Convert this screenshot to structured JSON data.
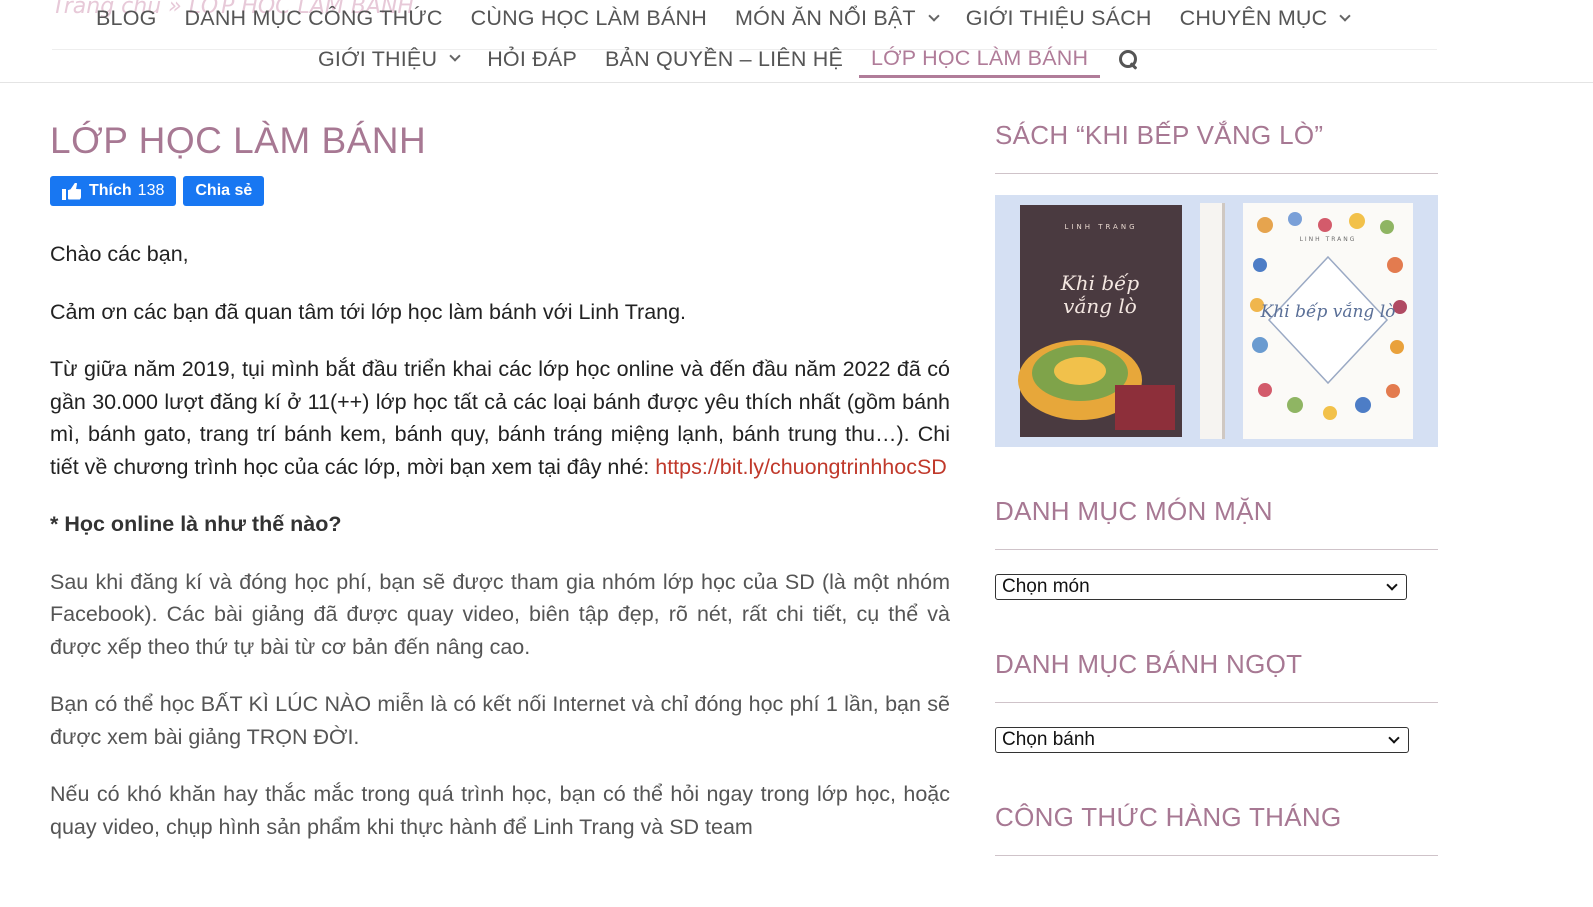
{
  "breadcrumb": {
    "home": "Trang chủ",
    "sep": "»",
    "current": "LỚP HỌC LÀM BÁNH"
  },
  "nav": {
    "row1": [
      {
        "label": "BLOG",
        "dropdown": false
      },
      {
        "label": "DANH MỤC CÔNG THỨC",
        "dropdown": false
      },
      {
        "label": "CÙNG HỌC LÀM BÁNH",
        "dropdown": false
      },
      {
        "label": "MÓN ĂN NỔI BẬT",
        "dropdown": true
      },
      {
        "label": "GIỚI THIỆU SÁCH",
        "dropdown": false
      },
      {
        "label": "CHUYÊN MỤC",
        "dropdown": true
      }
    ],
    "row2": [
      {
        "label": "GIỚI THIỆU",
        "dropdown": true
      },
      {
        "label": "HỎI ĐÁP",
        "dropdown": false
      },
      {
        "label": "BẢN QUYỀN – LIÊN HỆ",
        "dropdown": false
      },
      {
        "label": "LỚP HỌC LÀM BÁNH",
        "dropdown": false,
        "active": true
      }
    ],
    "search_icon": "search-icon"
  },
  "main": {
    "title": "LỚP HỌC LÀM BÁNH",
    "like_label": "Thích",
    "like_count": "138",
    "share_label": "Chia sẻ",
    "p1": "Chào các bạn,",
    "p2": "Cảm ơn các bạn đã quan tâm tới lớp học làm bánh với Linh Trang.",
    "p3": "Từ giữa năm 2019, tụi mình bắt đầu triển khai các lớp học online và đến đầu năm 2022 đã có gần 30.000 lượt đăng kí ở 11(++) lớp học tất cả các loại bánh được yêu thích nhất (gồm bánh mì, bánh gato, trang trí bánh kem, bánh quy, bánh tráng miệng lạnh, bánh trung thu…). Chi tiết về chương trình học của các lớp, mời bạn xem tại đây nhé: ",
    "p3_link": "https://bit.ly/chuongtrinhhocSD",
    "h1": "* Học online là như thế nào?",
    "p4": "Sau khi đăng kí và đóng học phí, bạn sẽ được tham gia nhóm lớp học của SD (là một nhóm Facebook). Các bài giảng đã được quay video, biên tập đẹp, rõ nét, rất chi tiết, cụ thể và được xếp theo thứ tự bài từ cơ bản đến nâng cao.",
    "p5": "Bạn có thể học BẤT KÌ LÚC NÀO miễn là có kết nối Internet và chỉ đóng học phí 1 lần, bạn sẽ được xem bài giảng TRỌN ĐỜI.",
    "p6": "Nếu có khó khăn hay thắc mắc trong quá trình học, bạn có thể hỏi ngay trong lớp học, hoặc quay video, chụp hình sản phẩm khi thực hành để Linh Trang và SD team"
  },
  "sidebar": {
    "w1_title": "SÁCH “KHI BẾP VẮNG LÒ”",
    "book_cover_text": "Khi bếp vắng lò",
    "book_author": "LINH TRANG",
    "w2_title": "DANH MỤC MÓN MẶN",
    "w2_select": "Chọn món",
    "w3_title": "DANH MỤC BÁNH NGỌT",
    "w3_select": "Chọn bánh",
    "w4_title": "CÔNG THỨC HÀNG THÁNG"
  },
  "colors": {
    "accent": "#a77893",
    "facebook": "#1877f2",
    "link": "#c0392b"
  }
}
